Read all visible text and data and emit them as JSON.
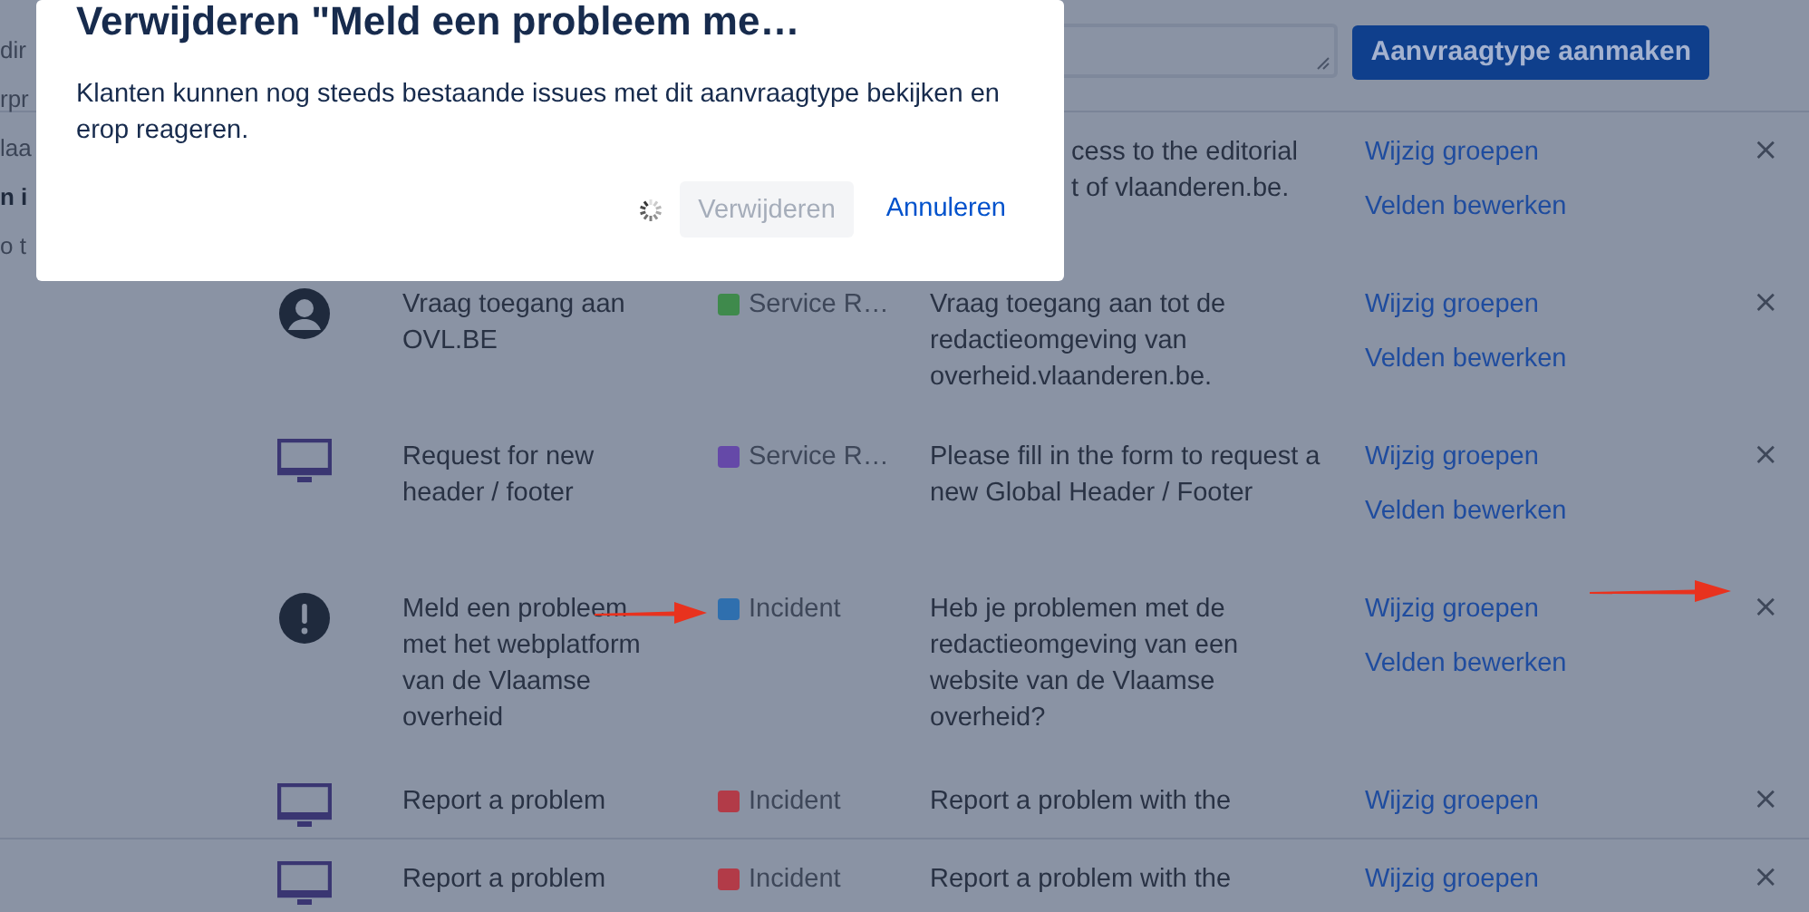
{
  "left_fragments": [
    {
      "text": "dir",
      "bold": false
    },
    {
      "text": "rpr",
      "bold": false
    },
    {
      "text": "laa",
      "bold": false
    },
    {
      "text": "n i",
      "bold": true
    },
    {
      "text": "o t",
      "bold": false
    }
  ],
  "create_button": "Aanvraagtype aanmaken",
  "request_types": [
    {
      "description": [
        "cess to the editorial",
        "t of vlaanderen.be."
      ],
      "actions": [
        "Wijzig groepen",
        "Velden bewerken"
      ],
      "remove": "×"
    },
    {
      "kind": "person",
      "name": [
        "Vraag toegang aan",
        "OVL.BE"
      ],
      "type": {
        "label": "Service R…",
        "color": "#3f8a4c"
      },
      "description": [
        "Vraag toegang aan tot de",
        "redactieomgeving van",
        "overheid.vlaanderen.be."
      ],
      "actions": [
        "Wijzig groepen",
        "Velden bewerken"
      ],
      "remove": "×"
    },
    {
      "kind": "monitor",
      "name": [
        "Request for new",
        "header / footer"
      ],
      "type": {
        "label": "Service R…",
        "color": "#6549a8"
      },
      "description": [
        "Please fill in the form to request a",
        "new Global Header / Footer"
      ],
      "actions": [
        "Wijzig groepen",
        "Velden bewerken"
      ],
      "remove": "×"
    },
    {
      "kind": "alert",
      "name": [
        "Meld een probleem",
        "met het webplatform",
        "van de Vlaamse",
        "overheid"
      ],
      "type": {
        "label": "Incident",
        "color": "#2f6fae"
      },
      "description": [
        "Heb je problemen met de",
        "redactieomgeving van een",
        "website van de Vlaamse",
        "overheid?"
      ],
      "actions": [
        "Wijzig groepen",
        "Velden bewerken"
      ],
      "remove": "×"
    },
    {
      "kind": "monitor",
      "name": [
        "Report a problem"
      ],
      "type": {
        "label": "Incident",
        "color": "#b23b48"
      },
      "description": [
        "Report a problem with the"
      ],
      "actions": [
        "Wijzig groepen"
      ],
      "remove": "×"
    },
    {
      "kind": "monitor",
      "name": [
        "Report a problem"
      ],
      "type": {
        "label": "Incident",
        "color": "#b23b48"
      },
      "description": [
        "Report a problem with the"
      ],
      "actions": [
        "Wijzig groepen"
      ],
      "remove": "×"
    }
  ],
  "dialog": {
    "title": "Verwijderen \"Meld een probleem me…",
    "message": "Klanten kunnen nog steeds bestaande issues met dit aanvraagtype bekijken en erop reageren.",
    "busy": true,
    "confirm": {
      "label": "Verwijderen",
      "disabled": true
    },
    "cancel": "Annuleren"
  }
}
